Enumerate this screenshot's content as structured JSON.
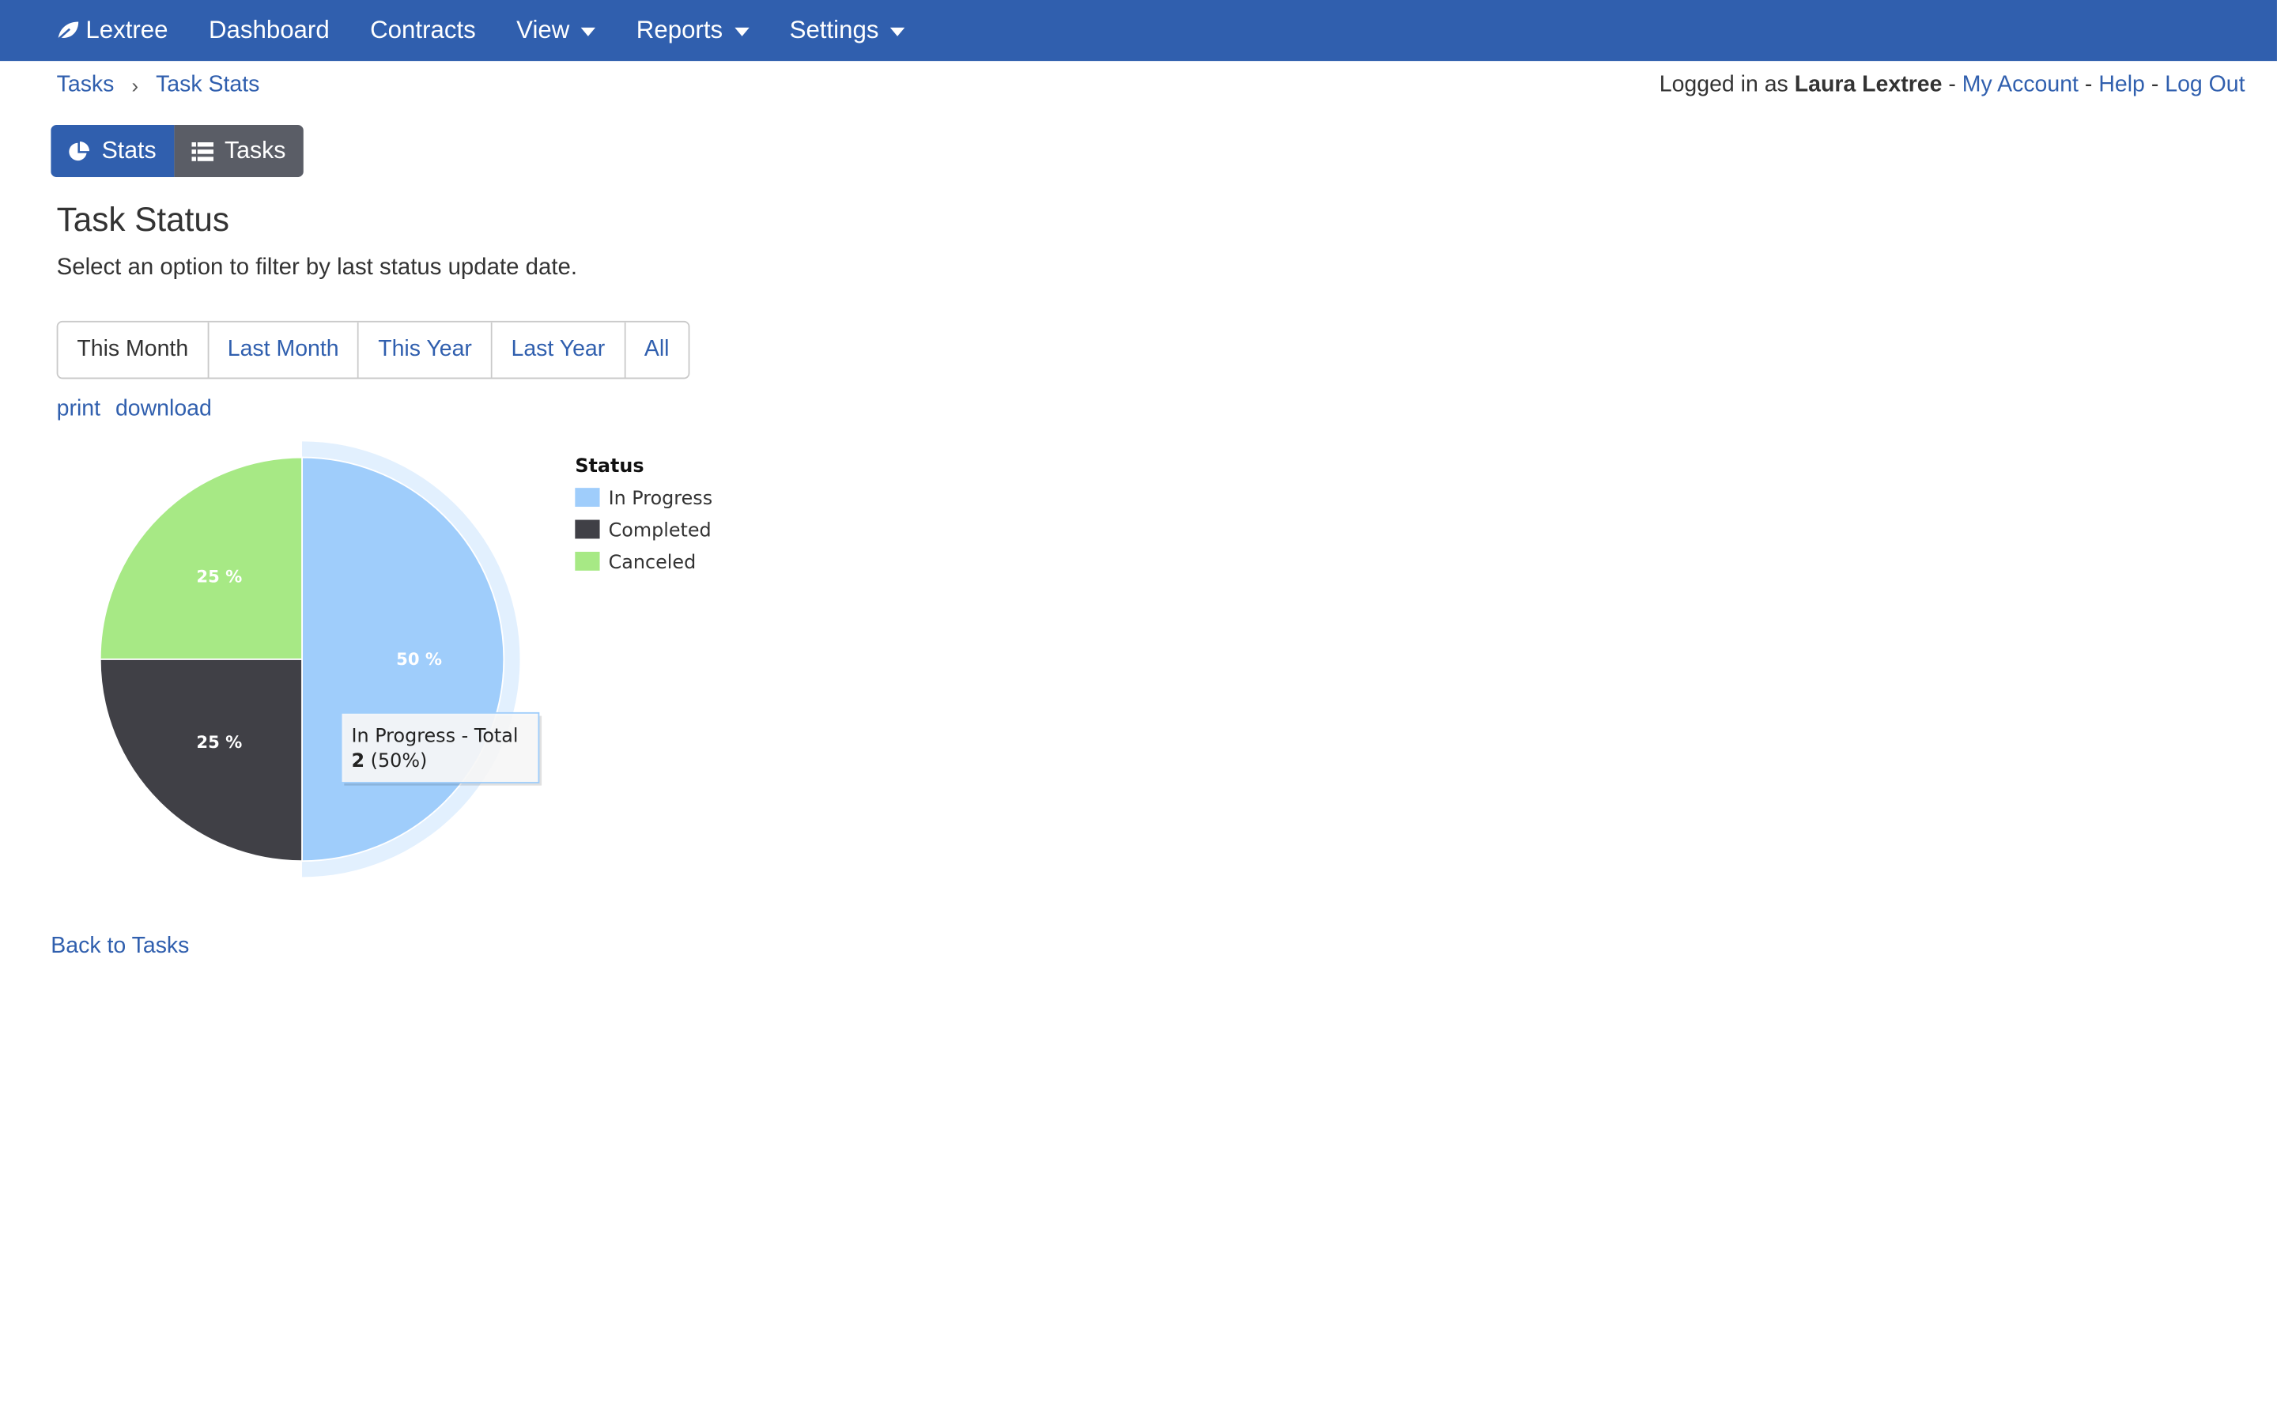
{
  "navbar": {
    "brand": "Lextree",
    "items": [
      {
        "label": "Dashboard"
      },
      {
        "label": "Contracts"
      },
      {
        "label": "View"
      },
      {
        "label": "Reports"
      },
      {
        "label": "Settings"
      }
    ]
  },
  "breadcrumb": {
    "items": [
      "Tasks",
      "Task Stats"
    ],
    "separator": "›"
  },
  "account": {
    "prefix": "Logged in as",
    "user": "Laura Lextree",
    "dash": "-",
    "my_account": "My Account",
    "help": "Help",
    "logout": "Log Out"
  },
  "view_toggle": {
    "stats": "Stats",
    "tasks": "Tasks"
  },
  "page": {
    "title": "Task Status",
    "subtitle": "Select an option to filter by last status update date."
  },
  "filters": {
    "options": [
      "This Month",
      "Last Month",
      "This Year",
      "Last Year",
      "All"
    ],
    "selected": "This Month"
  },
  "tools": {
    "print": "print",
    "download": "download"
  },
  "chart_data": {
    "type": "pie",
    "legend_title": "Status",
    "legend_position": "right",
    "slices": [
      {
        "name": "In Progress",
        "value": 2,
        "percent": 50,
        "label": "50 %",
        "color": "#9fcdfb"
      },
      {
        "name": "Completed",
        "value": 1,
        "percent": 25,
        "label": "25 %",
        "color": "#404046"
      },
      {
        "name": "Canceled",
        "value": 1,
        "percent": 25,
        "label": "25 %",
        "color": "#a7e985"
      }
    ],
    "tooltip": {
      "title": "In Progress - Total",
      "value": "2",
      "percent_text": "(50%)"
    }
  },
  "footer": {
    "back_link": "Back to Tasks"
  },
  "colors": {
    "brand": "#305fae",
    "toggle_inactive": "#5a5d66"
  }
}
